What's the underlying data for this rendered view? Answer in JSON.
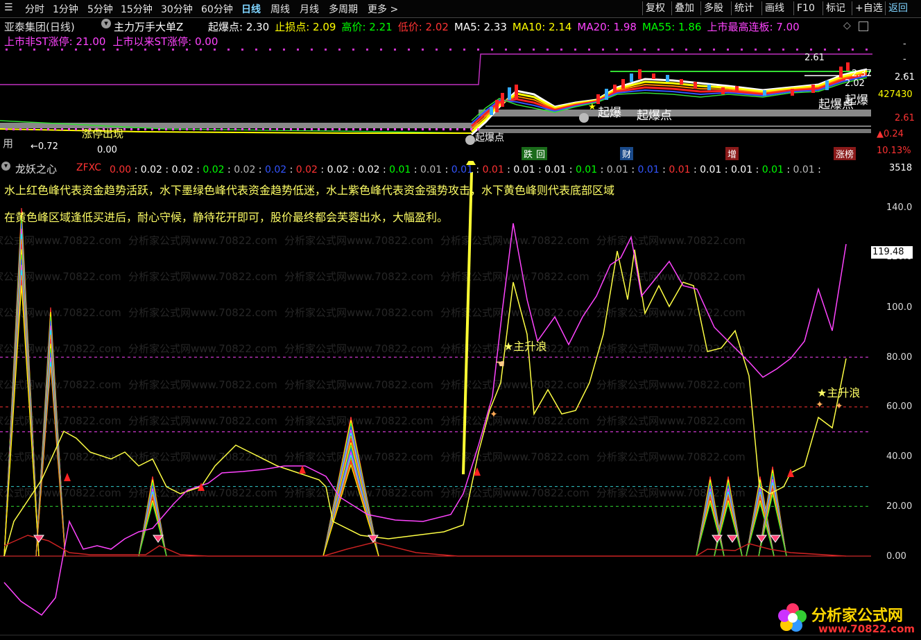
{
  "toolbar": {
    "periods": [
      "分时",
      "1分钟",
      "5分钟",
      "15分钟",
      "30分钟",
      "60分钟",
      "日线",
      "周线",
      "月线",
      "多周期",
      "更多 >"
    ],
    "active_period": "日线",
    "right_buttons": [
      "复权",
      "叠加",
      "多股",
      "统计",
      "画线",
      "F10",
      "标记",
      "+自选",
      "返回"
    ]
  },
  "main_header": {
    "stock": "亚泰集团(日线)",
    "indicator": "主力万手大单Z",
    "items": [
      {
        "label": "起爆点: 2.30",
        "color": "#ffffff"
      },
      {
        "label": "止损点: 2.09",
        "color": "#ffff00"
      },
      {
        "label": "高价: 2.21",
        "color": "#00ff00"
      },
      {
        "label": "低价: 2.02",
        "color": "#ff3333"
      },
      {
        "label": "MA5: 2.33",
        "color": "#ffffff"
      },
      {
        "label": "MA10: 2.14",
        "color": "#ffff00"
      },
      {
        "label": "MA20: 1.98",
        "color": "#ff44ff"
      },
      {
        "label": "MA55: 1.86",
        "color": "#00ff00"
      },
      {
        "label": "上市最高连板: 7.00",
        "color": "#ff44ff"
      }
    ],
    "line2": [
      {
        "label": "上市非ST涨停: 21.00",
        "color": "#ff44ff"
      },
      {
        "label": "上市以来ST涨停: 0.00",
        "color": "#ff44ff"
      }
    ]
  },
  "main_chart": {
    "right_axis": [
      "2.61",
      "427430",
      "2.61",
      "▲0.24",
      "10.13%"
    ],
    "right_axis_colors": [
      "#ffffff",
      "#ffff00",
      "#ff3333",
      "#ff3333",
      "#ff3333"
    ],
    "labels": {
      "peak": "2.61",
      "r1": "2.37",
      "r2": "2.02",
      "qb_right": "起爆",
      "qb_right2": "起爆点",
      "qb_mid": "起爆",
      "qb_mid2": "起爆点",
      "left_text": "涨停出现",
      "low": "←0.72",
      "zero": "0.00",
      "yong": "用",
      "qbd": "起爆点"
    },
    "tags": [
      {
        "label": "跌",
        "bg": "#1a6b1a"
      },
      {
        "label": "回",
        "bg": "#1a6b1a"
      },
      {
        "label": "财",
        "bg": "#1a4a8a"
      },
      {
        "label": "增",
        "bg": "#8a1a1a"
      },
      {
        "label": "涨榜",
        "bg": "#8a1a1a"
      }
    ]
  },
  "indicator": {
    "name": "龙妖之心",
    "param": "ZFXC",
    "values": [
      {
        "v": "0.00",
        "c": "#ff3333"
      },
      {
        "v": "0.02",
        "c": "#ffffff"
      },
      {
        "v": "0.02",
        "c": "#ffffff"
      },
      {
        "v": "0.02",
        "c": "#00ff00"
      },
      {
        "v": "0.02",
        "c": "#bbbbbb"
      },
      {
        "v": "0.02",
        "c": "#3355ff"
      },
      {
        "v": "0.02",
        "c": "#ff3333"
      },
      {
        "v": "0.02",
        "c": "#ffffff"
      },
      {
        "v": "0.02",
        "c": "#ffffff"
      },
      {
        "v": "0.01",
        "c": "#00ff00"
      },
      {
        "v": "0.01",
        "c": "#bbbbbb"
      },
      {
        "v": "0.01",
        "c": "#3355ff"
      },
      {
        "v": "0.01",
        "c": "#ff3333"
      },
      {
        "v": "0.01",
        "c": "#ffffff"
      },
      {
        "v": "0.01",
        "c": "#ffffff"
      },
      {
        "v": "0.01",
        "c": "#00ff00"
      },
      {
        "v": "0.01",
        "c": "#bbbbbb"
      },
      {
        "v": "0.01",
        "c": "#3355ff"
      },
      {
        "v": "0.01",
        "c": "#ff3333"
      },
      {
        "v": "0.01",
        "c": "#ffffff"
      },
      {
        "v": "0.01",
        "c": "#ffffff"
      },
      {
        "v": "0.01",
        "c": "#00ff00"
      },
      {
        "v": "0.01",
        "c": "#bbbbbb"
      }
    ],
    "right_top": "3518",
    "desc1": "水上红色峰代表资金趋势活跃，水下墨绿色峰代表资金趋势低迷，水上紫色峰代表资金强势攻击，水下黄色峰则代表底部区域",
    "desc2": "在黄色峰区域逢低买进后，耐心守候，静待花开即可，股价最终都会芙蓉出水，大幅盈利。",
    "axis": [
      "140.0",
      "120.0",
      "100.0",
      "80.00",
      "60.00",
      "40.00",
      "20.00",
      "0.00"
    ],
    "current": "119.48",
    "annotation": "主升浪",
    "annotation2": "主升浪",
    "watermark": "分析家公式网www.70822.com"
  },
  "logo": {
    "title": "分析家公式网",
    "url": "www.70822.com"
  }
}
